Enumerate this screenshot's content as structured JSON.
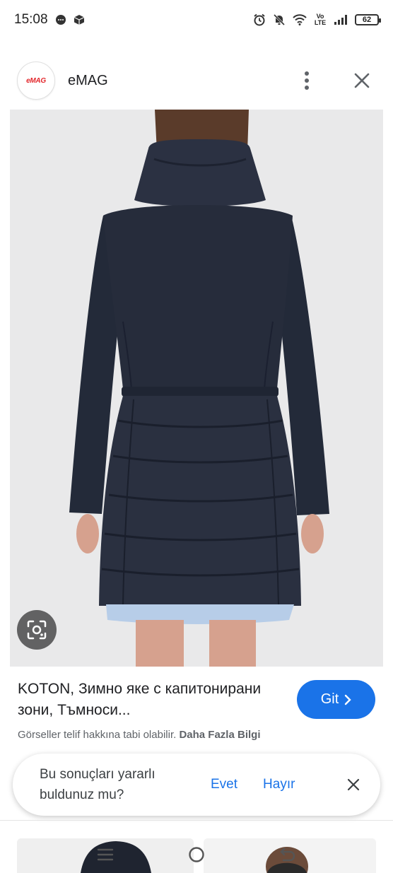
{
  "status_bar": {
    "time": "15:08",
    "network_label": "Vo LTE",
    "battery_level": "62",
    "icons": [
      "chat-bubble-icon",
      "package-icon",
      "alarm-icon",
      "bell-off-icon",
      "wifi-icon",
      "signal-icon",
      "battery-icon"
    ]
  },
  "header": {
    "logo_text": "eMAG",
    "site_name": "eMAG",
    "icons": [
      "more-vert-icon",
      "close-icon"
    ]
  },
  "image": {
    "description_icon": "lens-icon",
    "colors": {
      "coat": "#262c3b",
      "background": "#e9e9ea",
      "skirt": "#b7cde8"
    }
  },
  "result": {
    "title": "KOTON, Зимно яке с капитонирани зони, Тъмноси...",
    "go_button_label": "Git",
    "copyright_text": "Görseller telif hakkına tabi olabilir.",
    "more_info_label": "Daha Fazla Bilgi"
  },
  "feedback": {
    "question": "Bu sonuçları yararlı buldunuz mu?",
    "yes_label": "Evet",
    "no_label": "Hayır"
  },
  "colors": {
    "accent": "#1a73e8",
    "text_primary": "#202124",
    "text_secondary": "#5f6368"
  }
}
